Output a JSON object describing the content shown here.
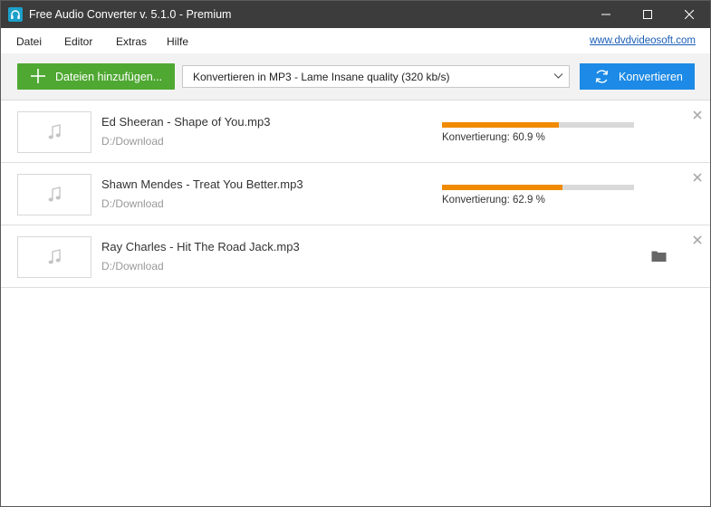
{
  "window": {
    "title": "Free Audio Converter v. 5.1.0 - Premium",
    "icon": "headphones-icon",
    "controls": [
      "minimize-icon",
      "maximize-icon",
      "close-icon"
    ]
  },
  "menu": {
    "items": [
      "Datei",
      "Editor",
      "Extras",
      "Hilfe"
    ],
    "link": "www.dvdvideosoft.com"
  },
  "toolbar": {
    "add_label": "Dateien hinzufügen...",
    "format": "Konvertieren in MP3 - Lame Insane quality (320 kb/s)",
    "convert_label": "Konvertieren"
  },
  "files": [
    {
      "name": "Ed Sheeran - Shape of You.mp3",
      "path": "D:/Download",
      "status": "Konvertierung: 60.9 %",
      "progress": 0.609
    },
    {
      "name": "Shawn Mendes - Treat You Better.mp3",
      "path": "D:/Download",
      "status": "Konvertierung: 62.9 %",
      "progress": 0.629
    },
    {
      "name": "Ray Charles - Hit The Road Jack.mp3",
      "path": "D:/Download",
      "done": true
    }
  ],
  "colors": {
    "titlebar": "#3c3c3c",
    "add_button": "#4fa832",
    "convert_button": "#1c8ae6",
    "progress_fill": "#f08a00",
    "progress_track": "#d9d9d9",
    "link": "#1a5db8"
  }
}
